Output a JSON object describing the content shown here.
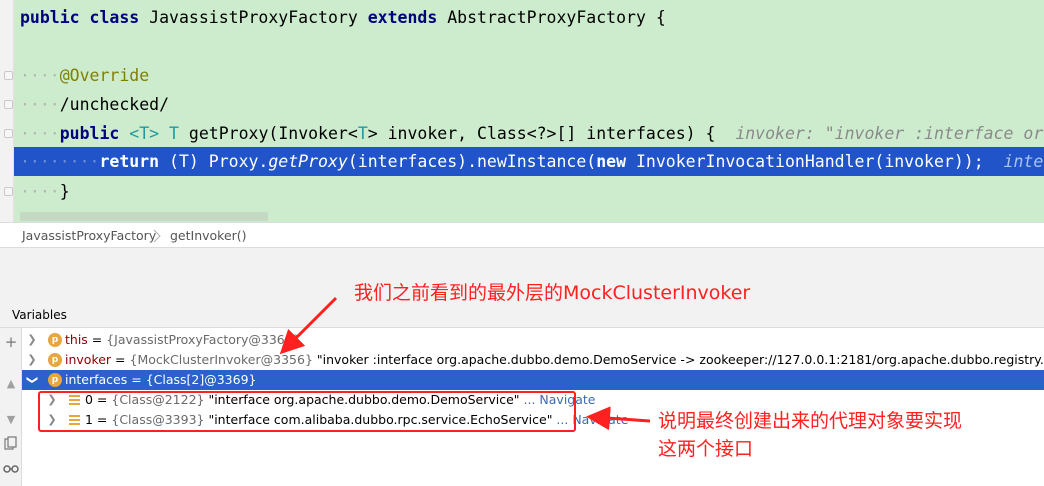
{
  "editor": {
    "class_decl": {
      "kw1": "public",
      "kw2": "class",
      "name": "JavassistProxyFactory",
      "kw3": "extends",
      "parent": "AbstractProxyFactory",
      "brace": "{"
    },
    "annotation": "@Override",
    "comment": "/unchecked/",
    "method_decl": {
      "kw": "public",
      "type_param": "<T>",
      "ret": "T",
      "signature_a": "getProxy(Invoker<",
      "t1": "T",
      "signature_b": "> invoker, Class<?>[] interfaces) {",
      "hint": "invoker: \"invoker :interface or"
    },
    "exec_line": {
      "kw_return": "return",
      "cast": "(T) Proxy.",
      "method": "getProxy",
      "mid": "(interfaces).newInstance(",
      "kw_new": "new",
      "tail": "InvokerInvocationHandler(invoker));",
      "hint": "inte"
    },
    "close_brace": "}"
  },
  "breadcrumb": {
    "class": "JavassistProxyFactory",
    "method": "getInvoker()"
  },
  "variables": {
    "title": "Variables",
    "rows": [
      {
        "name": "this",
        "eq": " = ",
        "ref": "{JavassistProxyFactory@3368}",
        "str": ""
      },
      {
        "name": "invoker",
        "eq": " = ",
        "ref": "{MockClusterInvoker@3356}",
        "str": " \"invoker :interface org.apache.dubbo.demo.DemoService -> zookeeper://127.0.0.1:2181/org.apache.dubbo.registry.RegistrySer"
      },
      {
        "name": "interfaces",
        "eq": " = ",
        "ref": "{Class[2]@3369}",
        "str": ""
      }
    ],
    "children": [
      {
        "name": "0",
        "eq": " = ",
        "ref": "{Class@2122}",
        "str": " \"interface org.apache.dubbo.demo.DemoService\"",
        "nav": " ... Navigate"
      },
      {
        "name": "1",
        "eq": " = ",
        "ref": "{Class@3393}",
        "str": " \"interface com.alibaba.dubbo.rpc.service.EchoService\"",
        "nav": " ... Navigate"
      }
    ]
  },
  "annotations": {
    "top": "我们之前看到的最外层的MockClusterInvoker",
    "right_line1": "说明最终创建出来的代理对象要实现",
    "right_line2": "这两个接口",
    "color": "#ff2020"
  },
  "colors": {
    "editor_bg": "#cdeccd",
    "exec_line": "#2154c9",
    "selected_row": "#2a62c9",
    "keyword": "#000080",
    "annotation": "#808000"
  },
  "icons": [
    "fold-icon",
    "add-icon",
    "up-arrow-icon",
    "down-arrow-icon",
    "copy-icon",
    "watch-icon",
    "chevron-right-icon",
    "chevron-down-icon",
    "field-icon",
    "array-element-icon",
    "breadcrumb-separator-icon"
  ]
}
